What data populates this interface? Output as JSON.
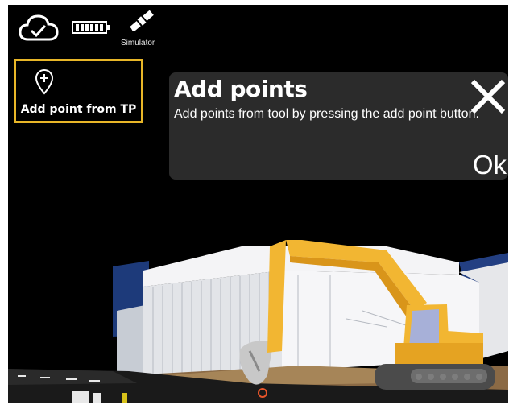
{
  "status": {
    "cloud_icon": "cloud-check-icon",
    "battery_icon": "battery-full-icon",
    "satellite_icon": "satellite-icon",
    "simulator_label": "Simulator"
  },
  "add_point_tp": {
    "icon": "map-pin-plus-icon",
    "label": "Add point from TP"
  },
  "tooltip": {
    "title": "Add points",
    "body": "Add points from tool by pressing the add point button.",
    "ok_label": "Ok",
    "close_icon": "close-icon"
  },
  "colors": {
    "highlight": "#e8b628",
    "tooltip_bg": "#2b2b2b",
    "excavator": "#f2b632",
    "building_blue": "#1f3f80"
  }
}
